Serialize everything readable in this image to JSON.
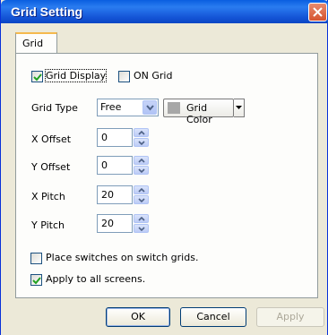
{
  "window": {
    "title": "Grid Setting"
  },
  "tabs": [
    {
      "label": "Grid"
    }
  ],
  "grid_display": {
    "label": "Grid Display",
    "checked": true
  },
  "on_grid": {
    "label": "ON Grid",
    "checked": false
  },
  "grid_type": {
    "label": "Grid Type",
    "value": "Free"
  },
  "grid_color": {
    "label": "Grid Color",
    "color": "#a7a7a7"
  },
  "fields": {
    "x_offset": {
      "label": "X Offset",
      "value": "0"
    },
    "y_offset": {
      "label": "Y Offset",
      "value": "0"
    },
    "x_pitch": {
      "label": "X Pitch",
      "value": "20"
    },
    "y_pitch": {
      "label": "Y Pitch",
      "value": "20"
    }
  },
  "place_switches": {
    "label": "Place switches on switch grids.",
    "checked": false
  },
  "apply_all": {
    "label": "Apply to all screens.",
    "checked": true
  },
  "buttons": {
    "ok": "OK",
    "cancel": "Cancel",
    "apply": "Apply"
  },
  "colors": {
    "title_bar": "#1454d6",
    "accent_tab": "#f5b94d",
    "check": "#21a121"
  }
}
